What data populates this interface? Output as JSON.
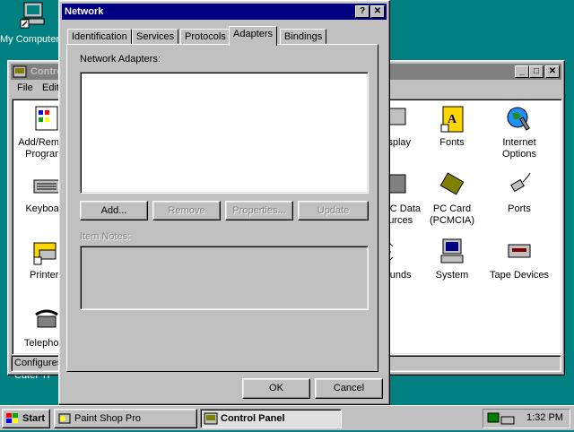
{
  "desktop": {
    "my_computer_label": "My Computer",
    "cuteftp_label": "CuteFTP"
  },
  "control_panel": {
    "title": "Control Panel",
    "menu": {
      "file": "File",
      "edit": "Edit"
    },
    "items": [
      {
        "label": "Add/Remove Programs",
        "icon": "add-remove-programs-icon"
      },
      {
        "label": "Keyboard",
        "icon": "keyboard-icon"
      },
      {
        "label": "Printers",
        "icon": "printers-icon"
      },
      {
        "label": "Telephony",
        "icon": "telephony-icon"
      },
      {
        "label": "Display",
        "icon": "display-icon"
      },
      {
        "label": "ODBC Data Sources",
        "icon": "odbc-icon"
      },
      {
        "label": "Sounds",
        "icon": "sounds-icon"
      },
      {
        "label": "Fonts",
        "icon": "fonts-icon"
      },
      {
        "label": "Internet Options",
        "icon": "internet-options-icon"
      },
      {
        "label": "PC Card (PCMCIA)",
        "icon": "pc-card-icon"
      },
      {
        "label": "Ports",
        "icon": "ports-icon"
      },
      {
        "label": "System",
        "icon": "system-icon"
      },
      {
        "label": "Tape Devices",
        "icon": "tape-devices-icon"
      }
    ],
    "status": "Configures"
  },
  "network": {
    "title": "Network",
    "help_btn": "?",
    "close_btn": "✕",
    "tabs": [
      "Identification",
      "Services",
      "Protocols",
      "Adapters",
      "Bindings"
    ],
    "active_tab": "Adapters",
    "adapters_label": "Network Adapters:",
    "buttons": {
      "add": "Add...",
      "remove": "Remove",
      "properties": "Properties...",
      "update": "Update"
    },
    "item_notes_label": "Item Notes:",
    "ok": "OK",
    "cancel": "Cancel"
  },
  "taskbar": {
    "start": "Start",
    "tasks": [
      "Paint Shop Pro",
      "Control Panel"
    ],
    "active_task": "Control Panel",
    "clock": "1:32 PM"
  },
  "colors": {
    "desktop": "#008080",
    "active_title": "#000080",
    "inactive_title": "#808080",
    "face": "#c0c0c0"
  }
}
